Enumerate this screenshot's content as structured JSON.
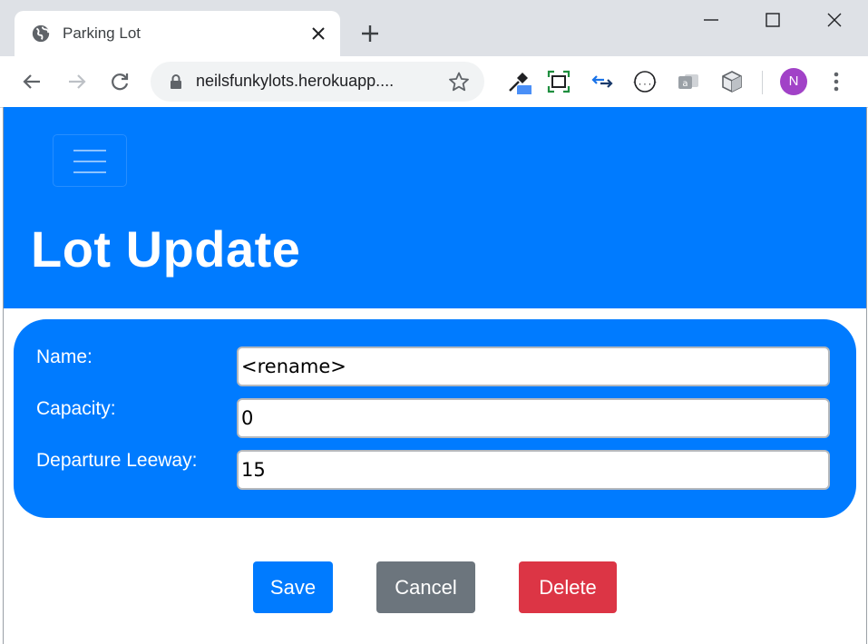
{
  "browser": {
    "tab": {
      "title": "Parking Lot"
    },
    "omnibox": {
      "url": "neilsfunkylots.herokuapp...."
    },
    "profile": {
      "initial": "N",
      "color": "#a142c7"
    }
  },
  "page": {
    "title": "Lot Update",
    "accent_color": "#007bff",
    "form": {
      "fields": [
        {
          "label": "Name:",
          "value": "<rename>"
        },
        {
          "label": "Capacity:",
          "value": "0"
        },
        {
          "label": "Departure Leeway:",
          "value": "15"
        }
      ]
    },
    "actions": {
      "save_label": "Save",
      "cancel_label": "Cancel",
      "delete_label": "Delete",
      "save_color": "#007bff",
      "cancel_color": "#6c757d",
      "delete_color": "#dc3545"
    }
  }
}
